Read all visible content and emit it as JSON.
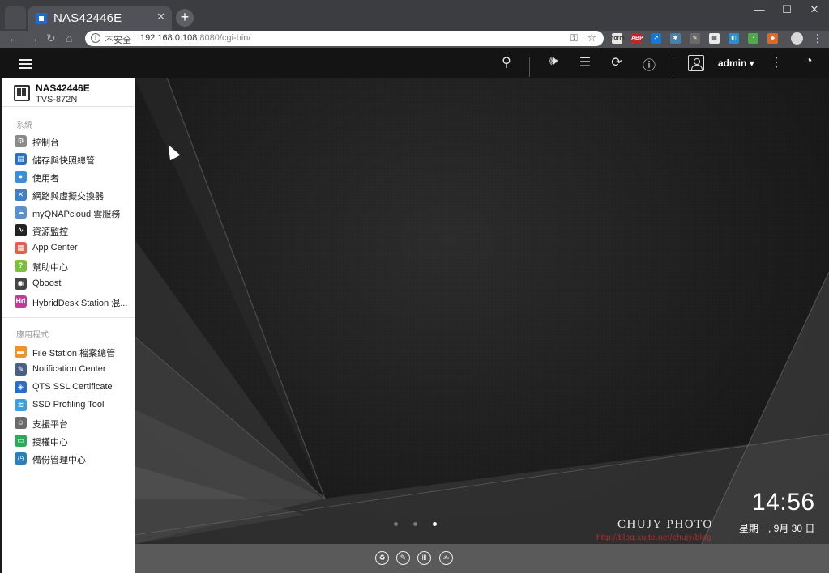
{
  "browser": {
    "tab_title": "NAS42446E",
    "tab_close": "✕",
    "new_tab": "+",
    "security_label": "不安全",
    "url_host": "192.168.0.108",
    "url_rest": ":8080/cgi-bin/",
    "window_controls": [
      "—",
      "☐",
      "✕"
    ],
    "extensions": [
      {
        "name": "form-ext-icon",
        "label": "form",
        "color": "#e8e8e8"
      },
      {
        "name": "adblock-ext-icon",
        "label": "ABP",
        "color": "#c0262d"
      },
      {
        "name": "share-ext-icon",
        "label": "↗",
        "color": "#1b74d9"
      },
      {
        "name": "bug-ext-icon",
        "label": "✱",
        "color": "#4a7fa8"
      },
      {
        "name": "pin-ext-icon",
        "label": "✎",
        "color": "#6a6a6a"
      },
      {
        "name": "qr-ext-icon",
        "label": "▦",
        "color": "#e9e9e9"
      },
      {
        "name": "tab-ext-icon",
        "label": "◧",
        "color": "#2e8ec8"
      },
      {
        "name": "pie-ext-icon",
        "label": "◔",
        "color": "#52a84f"
      },
      {
        "name": "shield-ext-icon",
        "label": "◆",
        "color": "#e2632c"
      }
    ]
  },
  "topbar": {
    "user": "admin",
    "user_caret": "▾",
    "icons": [
      "search-icon",
      "volume-icon",
      "tasks-icon",
      "sync-icon",
      "info-icon",
      "profile-icon",
      "more-icon",
      "dashboard-icon"
    ]
  },
  "sidebar": {
    "nas_name": "NAS42446E",
    "nas_model": "TVS-872N",
    "system_label": "系統",
    "system_items": [
      {
        "label": "控制台",
        "icon": "gear-icon",
        "color": "#8a8a8a",
        "glyph": "⚙"
      },
      {
        "label": "儲存與快照總管",
        "icon": "storage-icon",
        "color": "#2f6fbf",
        "glyph": "▤"
      },
      {
        "label": "使用者",
        "icon": "user-icon",
        "color": "#3b8fd6",
        "glyph": "●"
      },
      {
        "label": "網路與虛擬交換器",
        "icon": "network-icon",
        "color": "#3f7ec9",
        "glyph": "✕"
      },
      {
        "label": "myQNAPcloud 雲服務",
        "icon": "cloud-icon",
        "color": "#5a8fd0",
        "glyph": "☁"
      },
      {
        "label": "資源監控",
        "icon": "monitor-icon",
        "color": "#222222",
        "glyph": "∿"
      },
      {
        "label": "App Center",
        "icon": "grid-icon",
        "color": "#e0624c",
        "glyph": "▦"
      },
      {
        "label": "幫助中心",
        "icon": "help-icon",
        "color": "#7bbf3f",
        "glyph": "?"
      },
      {
        "label": "Qboost",
        "icon": "qboost-icon",
        "color": "#444444",
        "glyph": "◉"
      },
      {
        "label": "HybridDesk Station 混...",
        "icon": "hd-icon",
        "color": "#c23a9a",
        "glyph": "Hd"
      }
    ],
    "apps_label": "應用程式",
    "app_items": [
      {
        "label": "File Station 檔案總管",
        "icon": "folder-icon",
        "color": "#f0922b",
        "glyph": "▬"
      },
      {
        "label": "Notification Center",
        "icon": "notification-icon",
        "color": "#4a5f86",
        "glyph": "✎"
      },
      {
        "label": "QTS SSL Certificate",
        "icon": "certificate-icon",
        "color": "#2b6cc4",
        "glyph": "◈"
      },
      {
        "label": "SSD Profiling Tool",
        "icon": "ssd-icon",
        "color": "#3f9fd8",
        "glyph": "≋"
      },
      {
        "label": "支援平台",
        "icon": "support-icon",
        "color": "#6b6b6b",
        "glyph": "☺"
      },
      {
        "label": "授權中心",
        "icon": "license-icon",
        "color": "#2ea85a",
        "glyph": "▭"
      },
      {
        "label": "備份管理中心",
        "icon": "backup-icon",
        "color": "#2a7fb8",
        "glyph": "◷"
      }
    ]
  },
  "desktop": {
    "time": "14:56",
    "date": "星期一, 9月 30 日",
    "watermark": "CHUJY PHOTO",
    "watermark_url": "http://blog.xuite.net/chujy/blog",
    "page_dots": 3,
    "active_dot": 3
  },
  "bottombar": {
    "icons": [
      "recycle-icon",
      "wrench-icon",
      "columns-icon",
      "edit-icon"
    ]
  }
}
